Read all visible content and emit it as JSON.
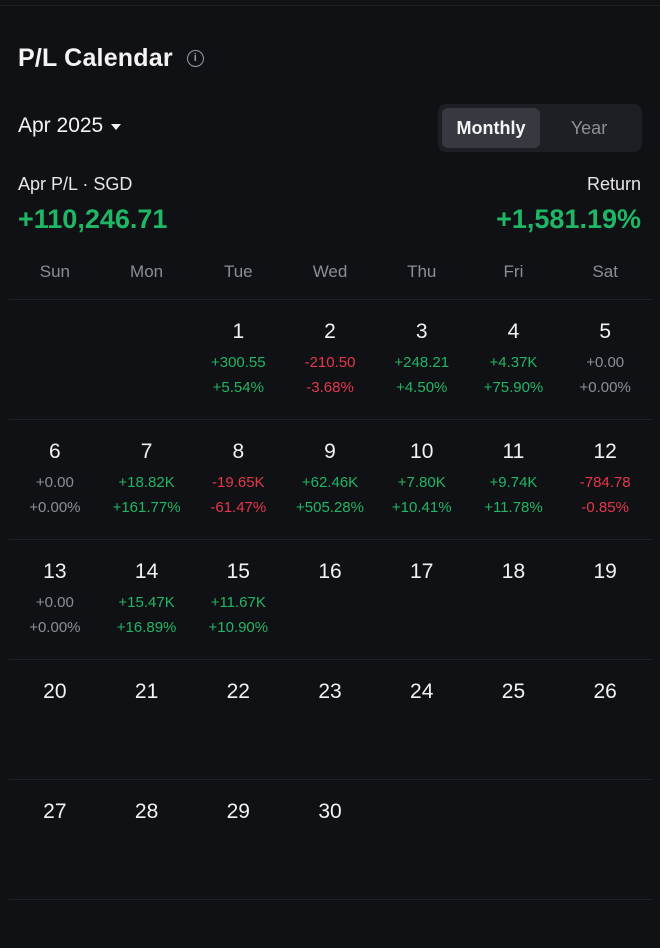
{
  "header": {
    "title": "P/L Calendar",
    "info_icon": "info-icon"
  },
  "month_select": {
    "label": "Apr 2025",
    "icon": "caret-down-icon"
  },
  "view_toggle": {
    "options": [
      "Monthly",
      "Year"
    ],
    "active": "Monthly"
  },
  "summary": {
    "pl_label": "Apr P/L · SGD",
    "pl_value": "+110,246.71",
    "return_label": "Return",
    "return_value": "+1,581.19%"
  },
  "colors": {
    "positive": "#22b566",
    "negative": "#e5374c",
    "neutral": "#8d8f96",
    "background": "#101114"
  },
  "weekdays": [
    "Sun",
    "Mon",
    "Tue",
    "Wed",
    "Thu",
    "Fri",
    "Sat"
  ],
  "weeks": [
    [
      {
        "day": "",
        "pnl": "",
        "pct": "",
        "tone": ""
      },
      {
        "day": "",
        "pnl": "",
        "pct": "",
        "tone": ""
      },
      {
        "day": "1",
        "pnl": "+300.55",
        "pct": "+5.54%",
        "tone": "pos"
      },
      {
        "day": "2",
        "pnl": "-210.50",
        "pct": "-3.68%",
        "tone": "neg"
      },
      {
        "day": "3",
        "pnl": "+248.21",
        "pct": "+4.50%",
        "tone": "pos"
      },
      {
        "day": "4",
        "pnl": "+4.37K",
        "pct": "+75.90%",
        "tone": "pos"
      },
      {
        "day": "5",
        "pnl": "+0.00",
        "pct": "+0.00%",
        "tone": "zero"
      }
    ],
    [
      {
        "day": "6",
        "pnl": "+0.00",
        "pct": "+0.00%",
        "tone": "zero"
      },
      {
        "day": "7",
        "pnl": "+18.82K",
        "pct": "+161.77%",
        "tone": "pos"
      },
      {
        "day": "8",
        "pnl": "-19.65K",
        "pct": "-61.47%",
        "tone": "neg"
      },
      {
        "day": "9",
        "pnl": "+62.46K",
        "pct": "+505.28%",
        "tone": "pos"
      },
      {
        "day": "10",
        "pnl": "+7.80K",
        "pct": "+10.41%",
        "tone": "pos"
      },
      {
        "day": "11",
        "pnl": "+9.74K",
        "pct": "+11.78%",
        "tone": "pos"
      },
      {
        "day": "12",
        "pnl": "-784.78",
        "pct": "-0.85%",
        "tone": "neg"
      }
    ],
    [
      {
        "day": "13",
        "pnl": "+0.00",
        "pct": "+0.00%",
        "tone": "zero"
      },
      {
        "day": "14",
        "pnl": "+15.47K",
        "pct": "+16.89%",
        "tone": "pos"
      },
      {
        "day": "15",
        "pnl": "+11.67K",
        "pct": "+10.90%",
        "tone": "pos"
      },
      {
        "day": "16",
        "pnl": "",
        "pct": "",
        "tone": ""
      },
      {
        "day": "17",
        "pnl": "",
        "pct": "",
        "tone": ""
      },
      {
        "day": "18",
        "pnl": "",
        "pct": "",
        "tone": ""
      },
      {
        "day": "19",
        "pnl": "",
        "pct": "",
        "tone": ""
      }
    ],
    [
      {
        "day": "20",
        "pnl": "",
        "pct": "",
        "tone": ""
      },
      {
        "day": "21",
        "pnl": "",
        "pct": "",
        "tone": ""
      },
      {
        "day": "22",
        "pnl": "",
        "pct": "",
        "tone": ""
      },
      {
        "day": "23",
        "pnl": "",
        "pct": "",
        "tone": ""
      },
      {
        "day": "24",
        "pnl": "",
        "pct": "",
        "tone": ""
      },
      {
        "day": "25",
        "pnl": "",
        "pct": "",
        "tone": ""
      },
      {
        "day": "26",
        "pnl": "",
        "pct": "",
        "tone": ""
      }
    ],
    [
      {
        "day": "27",
        "pnl": "",
        "pct": "",
        "tone": ""
      },
      {
        "day": "28",
        "pnl": "",
        "pct": "",
        "tone": ""
      },
      {
        "day": "29",
        "pnl": "",
        "pct": "",
        "tone": ""
      },
      {
        "day": "30",
        "pnl": "",
        "pct": "",
        "tone": ""
      },
      {
        "day": "",
        "pnl": "",
        "pct": "",
        "tone": ""
      },
      {
        "day": "",
        "pnl": "",
        "pct": "",
        "tone": ""
      },
      {
        "day": "",
        "pnl": "",
        "pct": "",
        "tone": ""
      }
    ]
  ]
}
